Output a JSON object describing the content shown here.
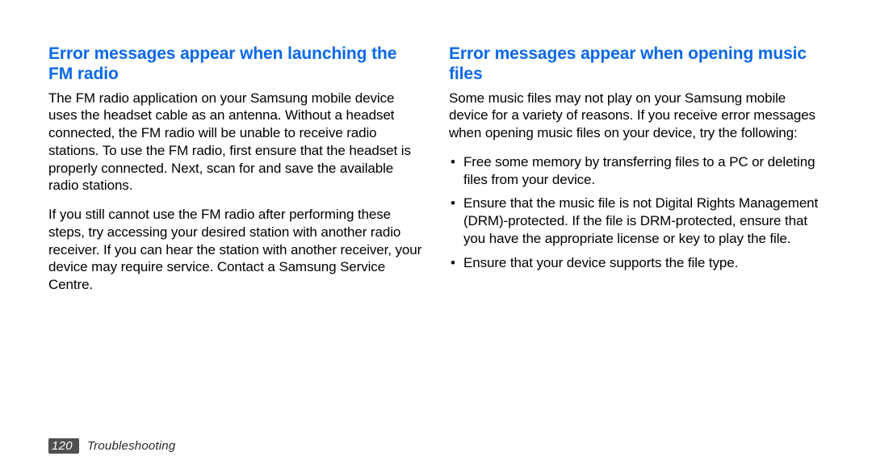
{
  "left": {
    "heading": "Error messages appear when launching the FM radio",
    "p1": "The FM radio application on your Samsung mobile device uses the headset cable as an antenna. Without a headset connected, the FM radio will be unable to receive radio stations. To use the FM radio, first ensure that the headset is properly connected. Next, scan for and save the available radio stations.",
    "p2": "If you still cannot use the FM radio after performing these steps, try accessing your desired station with another radio receiver. If you can hear the station with another receiver, your device may require service. Contact a Samsung Service Centre."
  },
  "right": {
    "heading": "Error messages appear when opening music files",
    "intro": "Some music files may not play on your Samsung mobile device for a variety of reasons. If you receive error messages when opening music files on your device, try the following:",
    "bullets": [
      "Free some memory by transferring files to a PC or deleting files from your device.",
      "Ensure that the music file is not Digital Rights Management (DRM)-protected. If the file is DRM-protected, ensure that you have the appropriate license or key to play the file.",
      "Ensure that your device supports the file type."
    ]
  },
  "footer": {
    "page": "120",
    "section": "Troubleshooting"
  }
}
